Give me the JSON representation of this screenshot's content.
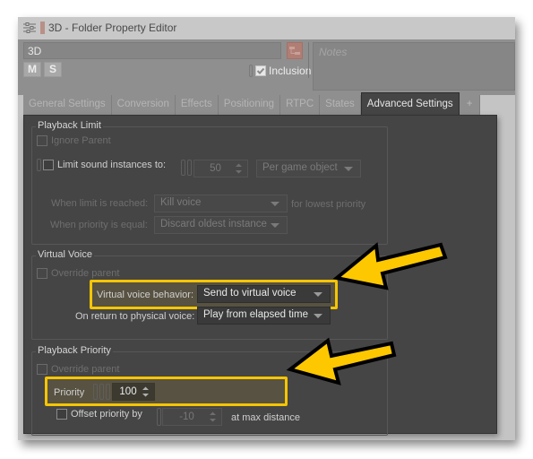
{
  "window": {
    "title": "3D - Folder Property Editor",
    "title_icon": "property-editor-icon",
    "color_swatch": "#b89088"
  },
  "header": {
    "name_value": "3D",
    "mute_label": "M",
    "solo_label": "S",
    "inclusion_label": "Inclusion",
    "inclusion_checked": true,
    "notes_placeholder": "Notes"
  },
  "tabs": [
    {
      "label": "General Settings",
      "active": false
    },
    {
      "label": "Conversion",
      "active": false
    },
    {
      "label": "Effects",
      "active": false
    },
    {
      "label": "Positioning",
      "active": false
    },
    {
      "label": "RTPC",
      "active": false
    },
    {
      "label": "States",
      "active": false
    },
    {
      "label": "Advanced Settings",
      "active": true
    },
    {
      "label": "+",
      "active": false
    }
  ],
  "playback_limit": {
    "title": "Playback Limit",
    "ignore_parent_label": "Ignore Parent",
    "limit_label": "Limit sound instances to:",
    "limit_value": "50",
    "scope_value": "Per game object",
    "when_limit_label": "When limit is reached:",
    "when_limit_value": "Kill voice",
    "when_limit_suffix": "for lowest priority",
    "when_equal_label": "When priority is equal:",
    "when_equal_value": "Discard oldest instance"
  },
  "virtual_voice": {
    "title": "Virtual Voice",
    "override_label": "Override parent",
    "behavior_label": "Virtual voice behavior:",
    "behavior_value": "Send to virtual voice",
    "return_label": "On return to physical voice:",
    "return_value": "Play from elapsed time"
  },
  "playback_priority": {
    "title": "Playback Priority",
    "override_label": "Override parent",
    "priority_label": "Priority",
    "priority_value": "100",
    "offset_label": "Offset priority by",
    "offset_value": "-10",
    "offset_suffix": "at max distance"
  },
  "annotations": {
    "highlight_color": "#f6c500",
    "arrow_color": "#fdc800"
  }
}
